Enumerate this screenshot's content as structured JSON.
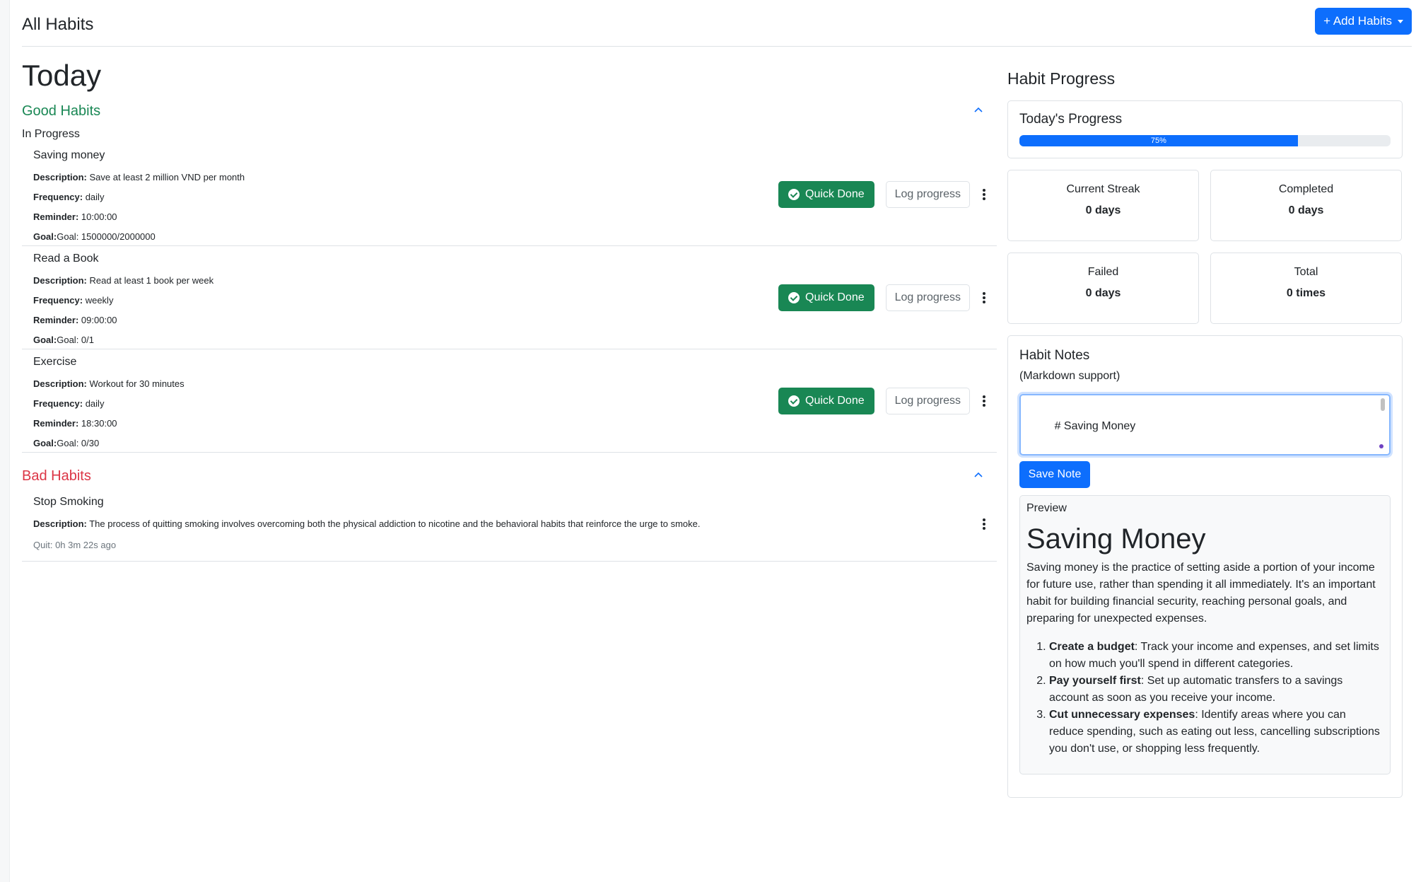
{
  "header": {
    "title": "All Habits",
    "add_button": "+ Add Habits"
  },
  "today": {
    "title": "Today",
    "good": {
      "title": "Good Habits",
      "subtitle": "In Progress",
      "habits": [
        {
          "name": "Saving money",
          "desc_label": "Description:",
          "desc": "Save at least 2 million VND per month",
          "freq_label": "Frequency:",
          "freq": "daily",
          "rem_label": "Reminder:",
          "rem": "10:00:00",
          "goal_label": "Goal:",
          "goal": "Goal: 1500000/2000000"
        },
        {
          "name": "Read a Book",
          "desc_label": "Description:",
          "desc": "Read at least 1 book per week",
          "freq_label": "Frequency:",
          "freq": "weekly",
          "rem_label": "Reminder:",
          "rem": "09:00:00",
          "goal_label": "Goal:",
          "goal": "Goal: 0/1"
        },
        {
          "name": "Exercise",
          "desc_label": "Description:",
          "desc": "Workout for 30 minutes",
          "freq_label": "Frequency:",
          "freq": "daily",
          "rem_label": "Reminder:",
          "rem": "18:30:00",
          "goal_label": "Goal:",
          "goal": "Goal: 0/30"
        }
      ]
    },
    "bad": {
      "title": "Bad Habits",
      "habits": [
        {
          "name": "Stop Smoking",
          "desc_label": "Description:",
          "desc": "The process of quitting smoking involves overcoming both the physical addiction to nicotine and the behavioral habits that reinforce the urge to smoke.",
          "quit": "Quit: 0h 3m 22s ago"
        }
      ]
    },
    "actions": {
      "quick_done": "Quick Done",
      "log_progress": "Log progress"
    }
  },
  "progress": {
    "title": "Habit Progress",
    "today_title": "Today's Progress",
    "percent_label": "75%",
    "percent_value": 75,
    "stats": [
      {
        "label": "Current Streak",
        "value": "0 days"
      },
      {
        "label": "Completed",
        "value": "0 days"
      },
      {
        "label": "Failed",
        "value": "0 days"
      },
      {
        "label": "Total",
        "value": "0 times"
      }
    ]
  },
  "notes": {
    "title": "Habit Notes",
    "subtitle": "(Markdown support)",
    "textarea_value": "# Saving Money\n\nSaving money is the practice of setting aside a portion of your",
    "save_button": "Save Note",
    "preview_label": "Preview",
    "preview_heading": "Saving Money",
    "preview_paragraph": "Saving money is the practice of setting aside a portion of your income for future use, rather than spending it all immediately. It's an important habit for building financial security, reaching personal goals, and preparing for unexpected expenses.",
    "preview_list": [
      {
        "bold": "Create a budget",
        "text": ": Track your income and expenses, and set limits on how much you'll spend in different categories."
      },
      {
        "bold": "Pay yourself first",
        "text": ": Set up automatic transfers to a savings account as soon as you receive your income."
      },
      {
        "bold": "Cut unnecessary expenses",
        "text": ": Identify areas where you can reduce spending, such as eating out less, cancelling subscriptions you don't use, or shopping less frequently."
      }
    ]
  },
  "colors": {
    "primary": "#0d6efd",
    "success": "#198754",
    "danger": "#dc3545"
  }
}
